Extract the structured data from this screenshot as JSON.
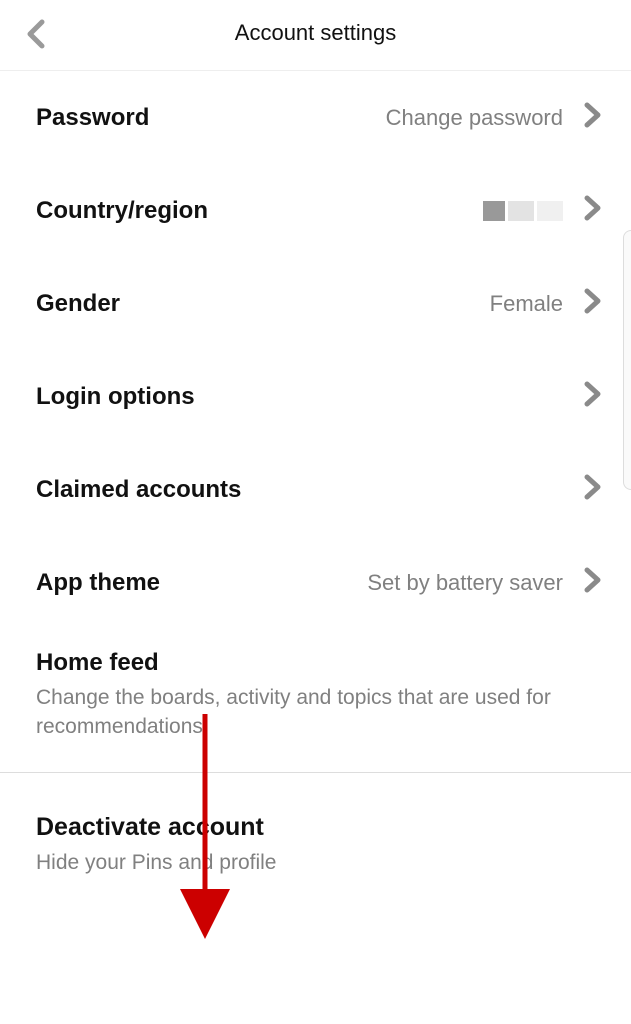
{
  "header": {
    "title": "Account settings"
  },
  "rows": {
    "password": {
      "label": "Password",
      "value": "Change password"
    },
    "country": {
      "label": "Country/region"
    },
    "gender": {
      "label": "Gender",
      "value": "Female"
    },
    "login": {
      "label": "Login options"
    },
    "claimed": {
      "label": "Claimed accounts"
    },
    "theme": {
      "label": "App theme",
      "value": "Set by battery saver"
    },
    "homefeed": {
      "label": "Home feed",
      "subtext": "Change the boards, activity and topics that are used for recommendations"
    },
    "deactivate": {
      "label": "Deactivate account",
      "subtext": "Hide your Pins and profile"
    }
  }
}
